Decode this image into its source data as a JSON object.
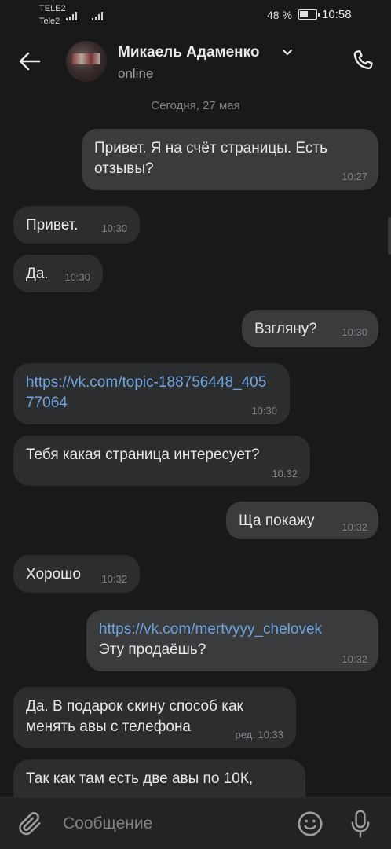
{
  "status_bar": {
    "carrier1": "TELE2",
    "carrier2": "Tele2",
    "battery_percent": "48 %",
    "time": "10:58",
    "battery_level": 0.48
  },
  "header": {
    "contact_name": "Микаель Адаменко",
    "status": "online"
  },
  "chat": {
    "date_separator": "Сегодня, 27 мая",
    "messages": [
      {
        "dir": "out",
        "text": "Привет. Я на счёт страницы. Есть отзывы?",
        "time": "10:27"
      },
      {
        "dir": "in",
        "text": "Привет.",
        "time": "10:30"
      },
      {
        "dir": "in",
        "text": "Да.",
        "time": "10:30"
      },
      {
        "dir": "out",
        "text": "Взгляну?",
        "time": "10:30"
      },
      {
        "dir": "in",
        "text": "https://vk.com/topic-188756448_40577064",
        "time": "10:30"
      },
      {
        "dir": "in",
        "text": "Тебя какая страница интересует?",
        "time": "10:32"
      },
      {
        "dir": "out",
        "text": "Ща покажу",
        "time": "10:32"
      },
      {
        "dir": "in",
        "text": "Хорошо",
        "time": "10:32"
      },
      {
        "dir": "out",
        "link": "https://vk.com/mertvyyy_chelovek",
        "text": "Эту продаёшь?",
        "time": "10:32"
      },
      {
        "dir": "in",
        "text": "Да. В подарок скину способ как менять авы с телефона",
        "time": "ред. 10:33"
      },
      {
        "dir": "in",
        "text": "Так как там есть две авы по 10К,",
        "time": ""
      }
    ]
  },
  "composer": {
    "placeholder": "Сообщение"
  }
}
